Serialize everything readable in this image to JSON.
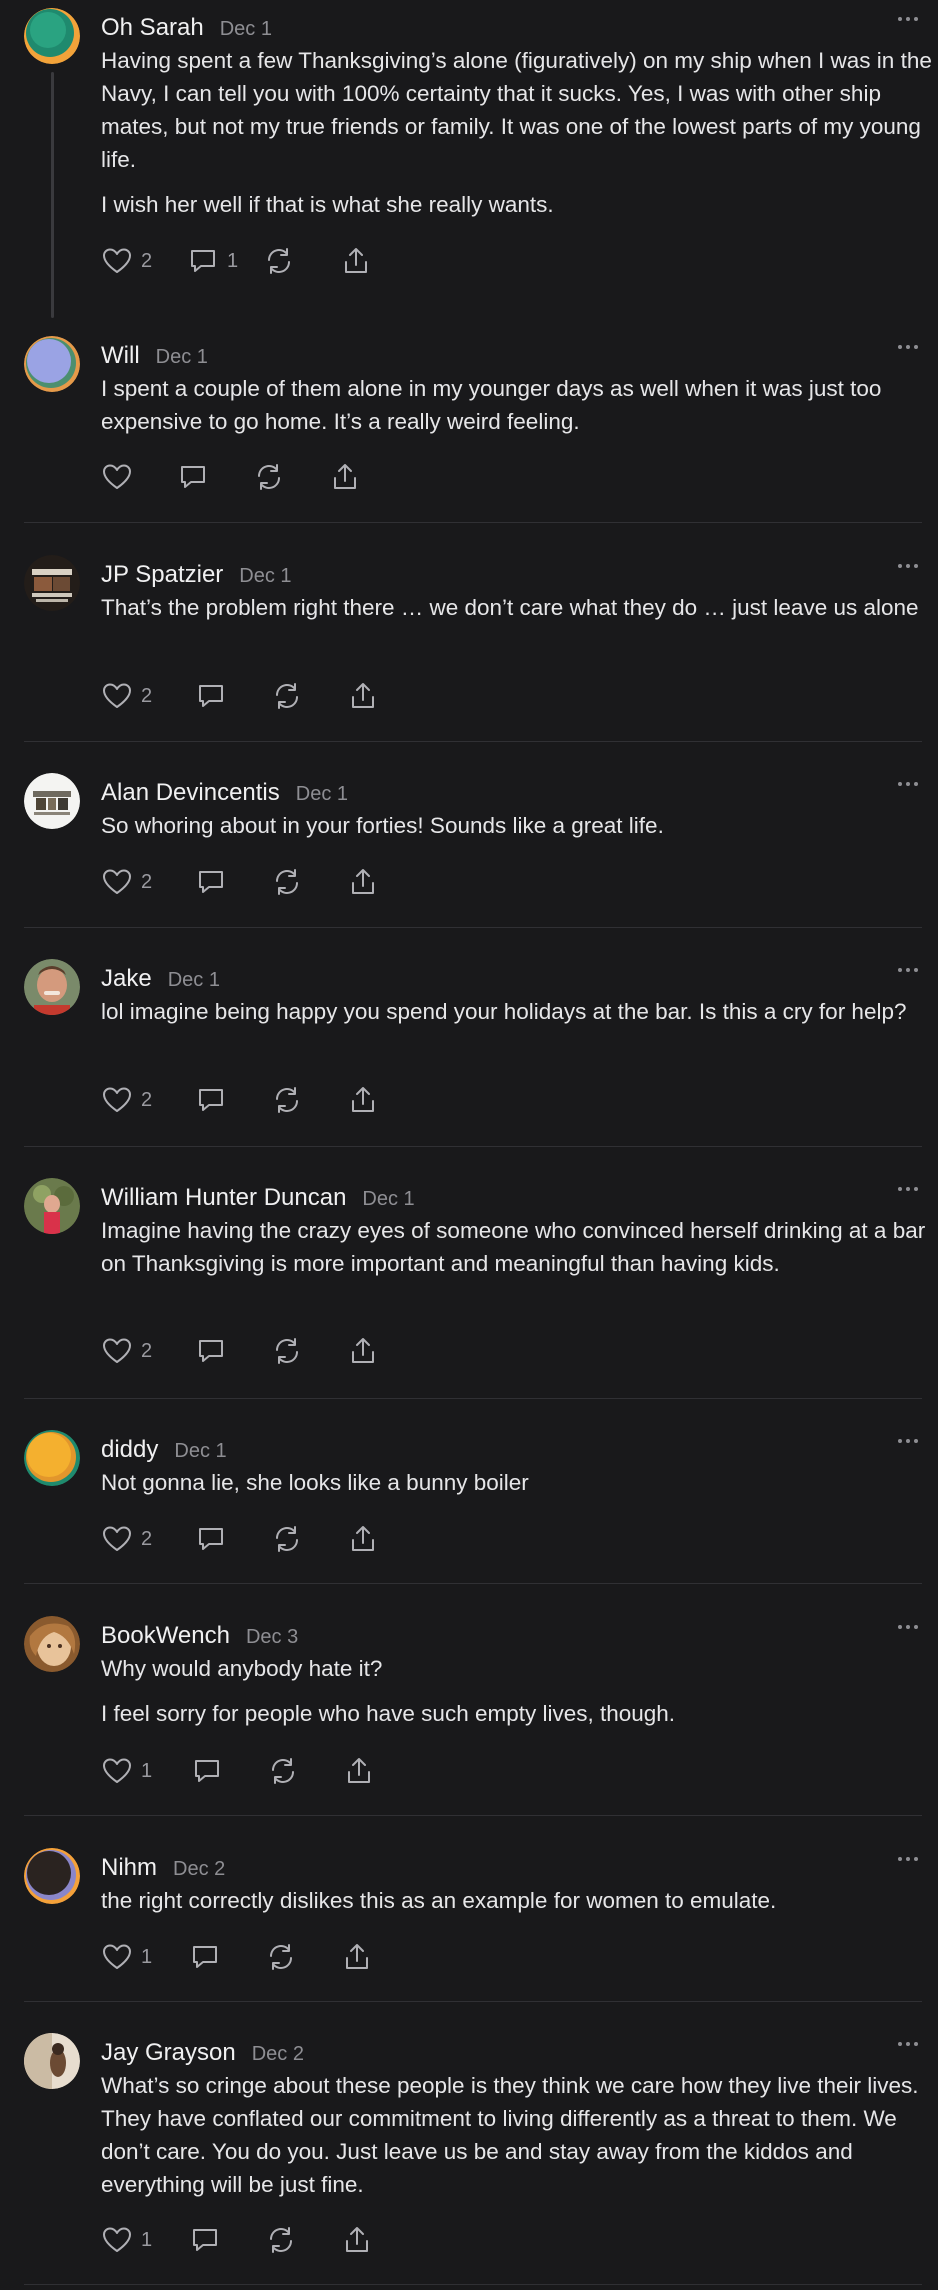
{
  "colors": {
    "background": "#19191b",
    "text": "#e6e6e8",
    "muted": "#8e8e93",
    "divider": "#303034"
  },
  "icons": {
    "like": "heart-icon",
    "reply": "comment-icon",
    "restack": "restack-icon",
    "share": "share-icon",
    "more": "more-icon"
  },
  "comments": [
    {
      "author": "Oh Sarah",
      "date": "Dec 1",
      "paragraphs": [
        "Having spent a few Thanksgiving’s alone (figuratively) on my ship when I was in the Navy, I can tell you with 100% certainty that it sucks. Yes, I was with other ship mates, but not my true friends or family. It was one of the lowest parts of my young life.",
        "I wish her well if that is what she really wants."
      ],
      "likes": "2",
      "replies": "1"
    },
    {
      "author": "Will",
      "date": "Dec 1",
      "paragraphs": [
        "I spent a couple of them alone in my younger days as well when it was just too expensive to go home. It’s a really weird feeling."
      ],
      "likes": "",
      "replies": ""
    },
    {
      "author": "JP Spatzier",
      "date": "Dec 1",
      "paragraphs": [
        "That’s the problem right there … we don’t care what they do … just leave us alone"
      ],
      "likes": "2",
      "replies": ""
    },
    {
      "author": "Alan Devincentis",
      "date": "Dec 1",
      "paragraphs": [
        "So whoring about in your forties! Sounds like a great life."
      ],
      "likes": "2",
      "replies": ""
    },
    {
      "author": "Jake",
      "date": "Dec 1",
      "paragraphs": [
        "lol imagine being happy you spend your holidays at the bar. Is this a cry for help?"
      ],
      "likes": "2",
      "replies": ""
    },
    {
      "author": "William Hunter Duncan",
      "date": "Dec 1",
      "paragraphs": [
        "Imagine having the crazy eyes of someone who convinced herself drinking at a bar on Thanksgiving is more important and meaningful than having kids."
      ],
      "likes": "2",
      "replies": ""
    },
    {
      "author": "diddy",
      "date": "Dec 1",
      "paragraphs": [
        "Not gonna lie, she looks like a bunny boiler"
      ],
      "likes": "2",
      "replies": ""
    },
    {
      "author": "BookWench",
      "date": "Dec 3",
      "paragraphs": [
        "Why would anybody hate it?",
        "I feel sorry for people who have such empty lives, though."
      ],
      "likes": "1",
      "replies": ""
    },
    {
      "author": "Nihm",
      "date": "Dec 2",
      "paragraphs": [
        "the right correctly dislikes this as an example for women to emulate."
      ],
      "likes": "1",
      "replies": ""
    },
    {
      "author": "Jay Grayson",
      "date": "Dec 2",
      "paragraphs": [
        "What’s so cringe about these people is they think we care how they live their lives. They have conflated our commitment to living differently as a threat to them. We don’t care. You do you. Just leave us be and stay away from the kiddos and everything will be just fine."
      ],
      "likes": "1",
      "replies": ""
    }
  ]
}
